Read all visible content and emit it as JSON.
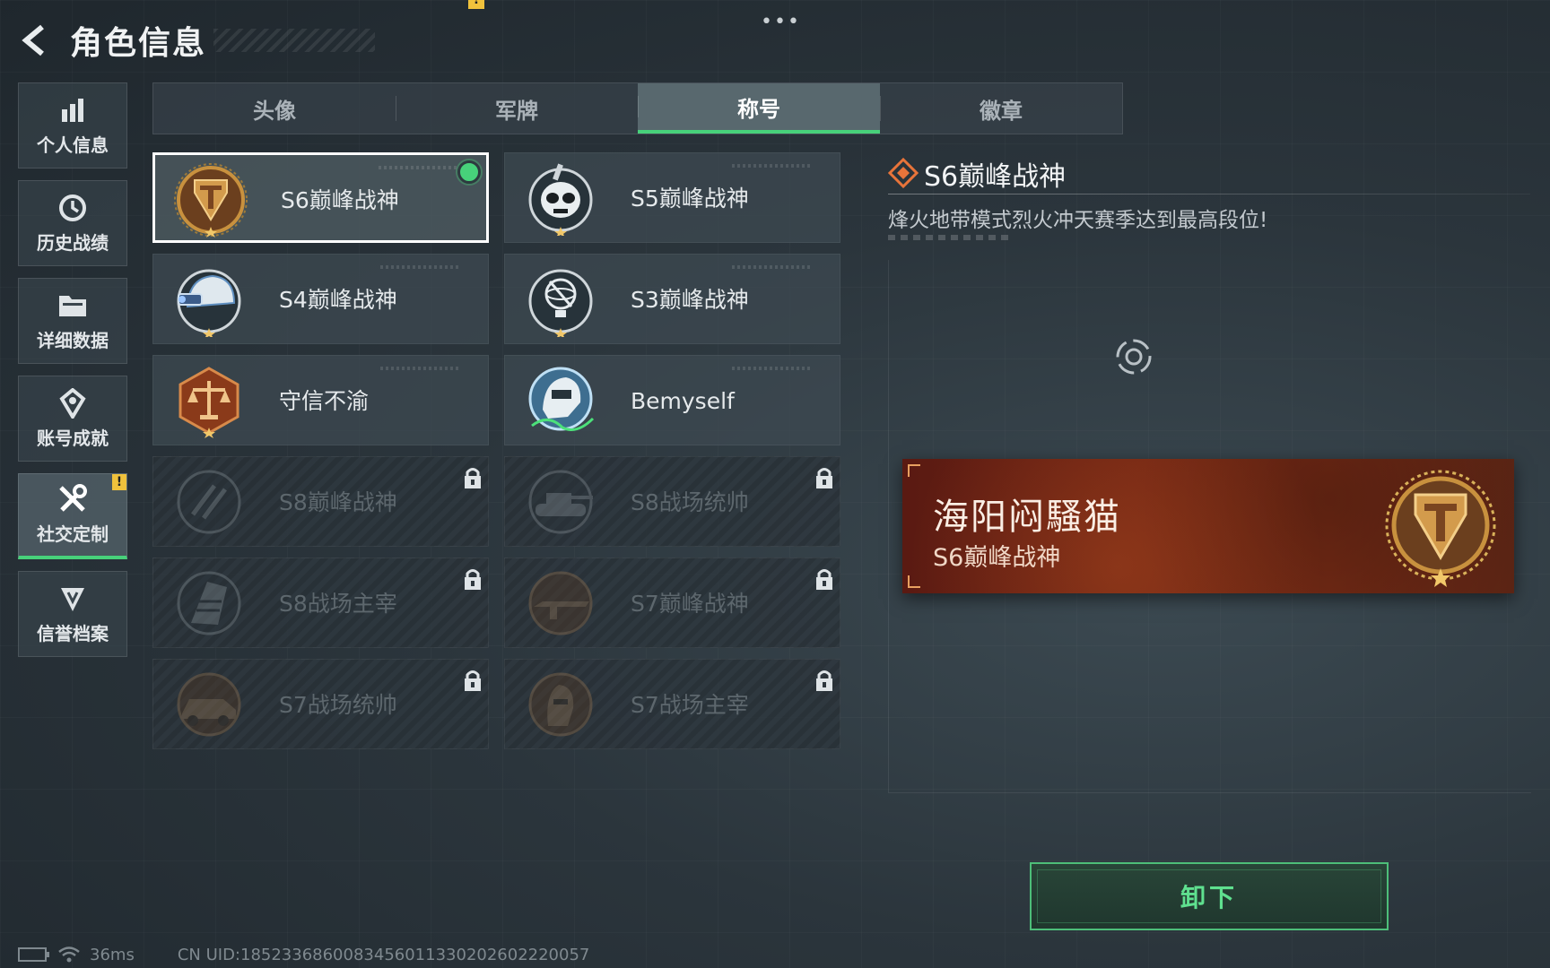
{
  "header": {
    "title": "角色信息",
    "more": "•••"
  },
  "sidebar": {
    "items": [
      {
        "label": "个人信息",
        "icon": "bar-chart-icon",
        "active": false
      },
      {
        "label": "历史战绩",
        "icon": "history-clock-icon",
        "active": false
      },
      {
        "label": "详细数据",
        "icon": "folder-icon",
        "active": false
      },
      {
        "label": "账号成就",
        "icon": "achievement-medal-icon",
        "active": false
      },
      {
        "label": "社交定制",
        "icon": "tools-icon",
        "active": true,
        "badge": "!"
      },
      {
        "label": "信誉档案",
        "icon": "shield-credit-icon",
        "active": false
      }
    ]
  },
  "tabs": [
    {
      "label": "头像",
      "active": false
    },
    {
      "label": "军牌",
      "active": false
    },
    {
      "label": "称号",
      "active": true
    },
    {
      "label": "徽章",
      "active": false
    }
  ],
  "tab_badge": "!",
  "titles": [
    {
      "label": "S6巅峰战神",
      "emblem": "gold-t-shield-emblem",
      "locked": false,
      "selected": true,
      "equipped": true
    },
    {
      "label": "S5巅峰战神",
      "emblem": "skull-mask-emblem",
      "locked": false
    },
    {
      "label": "S4巅峰战神",
      "emblem": "helmet-nightvision-emblem",
      "locked": false
    },
    {
      "label": "S3巅峰战神",
      "emblem": "globe-trophy-emblem",
      "locked": false
    },
    {
      "label": "守信不渝",
      "emblem": "justice-scale-emblem",
      "locked": false
    },
    {
      "label": "Bemyself",
      "emblem": "soldier-signature-emblem",
      "locked": false
    },
    {
      "label": "S8巅峰战神",
      "emblem": "slash-emblem",
      "locked": true
    },
    {
      "label": "S8战场统帅",
      "emblem": "tank-emblem",
      "locked": true
    },
    {
      "label": "S8战场主宰",
      "emblem": "tower-emblem",
      "locked": true
    },
    {
      "label": "S7巅峰战神",
      "emblem": "rifle-emblem",
      "locked": true
    },
    {
      "label": "S7战场统帅",
      "emblem": "vehicle-emblem",
      "locked": true
    },
    {
      "label": "S7战场主宰",
      "emblem": "soldier-head-emblem",
      "locked": true
    }
  ],
  "detail": {
    "title": "S6巅峰战神",
    "description": "烽火地带模式烈火冲天赛季达到最高段位!"
  },
  "nameplate": {
    "player_name": "海阳闷騷猫",
    "title": "S6巅峰战神"
  },
  "action_button": "卸下",
  "footer": {
    "ping": "36ms",
    "uid": "CN UID:1852336860083456011330202602220057"
  },
  "colors": {
    "accent_green": "#47d17a",
    "badge_yellow": "#f0c23c",
    "nameplate_red": "#6f2414",
    "gold": "#c8913e"
  }
}
